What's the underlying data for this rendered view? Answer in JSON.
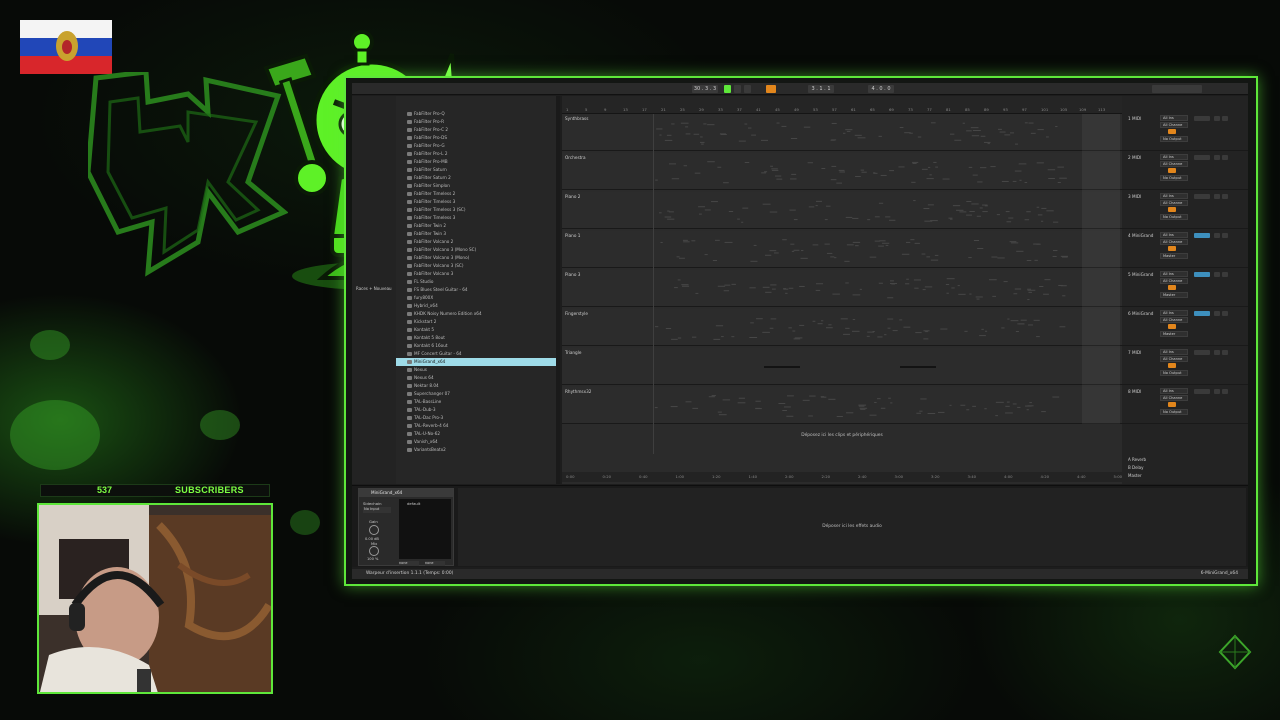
{
  "subscribers": {
    "count": "537",
    "label": "SUBSCRIBERS"
  },
  "daw": {
    "transport": {
      "bars": "30 . 3 . 3",
      "loop_start": "3 . 1 . 1",
      "loop_len": "4 . 0 . 0"
    },
    "browser_items": [
      "FabFilter Pro-Q",
      "FabFilter Pro-R",
      "FabFilter Pro-C 2",
      "FabFilter Pro-DS",
      "FabFilter Pro-G",
      "FabFilter Pro-L 2",
      "FabFilter Pro-MB",
      "FabFilter Saturn",
      "FabFilter Saturn 2",
      "FabFilter Simplon",
      "FabFilter Timeless 2",
      "FabFilter Timeless 3",
      "FabFilter Timeless 3 (SC)",
      "FabFilter Timeless 3",
      "FabFilter Twin 2",
      "FabFilter Twin 3",
      "FabFilter Volcano 2",
      "FabFilter Volcano 3 (Mono SC)",
      "FabFilter Volcano 3 (Mono)",
      "FabFilter Volcano 3 (SC)",
      "FabFilter Volcano 3",
      "FL Studio",
      "FS Blues Steel Guitar - 64",
      "fury800X",
      "Hybrid_x64",
      "KHDK Noisy Numero Edition x64",
      "Kickstart 2",
      "Kontakt 5",
      "Kontakt 5 8out",
      "Kontakt 6 16out",
      "MF Concert Guitar - 64",
      "MiniGrand_x64",
      "Nexus",
      "Nexus 64",
      "Nektar 8.04",
      "Superchanger 07",
      "TAL-BassLine",
      "TAL-Dub-3",
      "TAL-Dac Pro-3",
      "TAL-Reverb-4 64",
      "TAL-U-No-62",
      "Vanish_x64",
      "VariantsBeatx2"
    ],
    "browser_selected_index": 31,
    "browser_side": {
      "item": "Races + Nouveau"
    },
    "tracks": [
      {
        "name": "Synthbrass",
        "mixer": "1 MIDI"
      },
      {
        "name": "Orchestra",
        "mixer": "2 MIDI"
      },
      {
        "name": "Piano 2",
        "mixer": "3 MIDI"
      },
      {
        "name": "Piano 1",
        "mixer": "4 MiniGrand"
      },
      {
        "name": "Piano 3",
        "mixer": "5 MiniGrand"
      },
      {
        "name": "Fingerstyle",
        "mixer": "6 MiniGrand"
      },
      {
        "name": "Triangle",
        "mixer": "7 MIDI"
      },
      {
        "name": "Rhythmsx32",
        "mixer": "8 MIDI"
      }
    ],
    "mixer_labels": {
      "all_ins": "All Ins",
      "all_channels": "All Channe",
      "in": "In",
      "off": "OFF",
      "no_output": "No Output",
      "master": "Master"
    },
    "return_tracks": [
      "A Reverb",
      "B Delay",
      "Master"
    ],
    "drop_clips": "Déposez ici les clips et périphériques",
    "drop_audio": "Déposer ici les effets audio",
    "ruler_ticks": [
      "1",
      "5",
      "9",
      "13",
      "17",
      "21",
      "25",
      "29",
      "33",
      "37",
      "41",
      "45",
      "49",
      "53",
      "57",
      "61",
      "65",
      "69",
      "73",
      "77",
      "81",
      "85",
      "89",
      "93",
      "97",
      "101",
      "105",
      "109",
      "113"
    ],
    "time_ticks": [
      "0:00",
      "0:20",
      "0:40",
      "1:00",
      "1:20",
      "1:40",
      "2:00",
      "2:20",
      "2:40",
      "3:00",
      "3:20",
      "3:40",
      "4:00",
      "4:20",
      "4:40",
      "5:00"
    ],
    "instrument": {
      "name": "MiniGrand_x64",
      "preset": "default",
      "sidechain": "Sidechain",
      "no_input": "No Input",
      "gain": "Gain",
      "gain_val": "0.00 dB",
      "mix": "Mix",
      "mix_val": "100 %",
      "none": "none"
    },
    "status": {
      "left": "Warpeur d'insertion 1.1.1 (Temps: 0:00)",
      "right": "6-MiniGrand_x64"
    }
  },
  "colors": {
    "neon": "#5ee73a",
    "selection": "#9edbe8",
    "orange": "#e2861c"
  }
}
